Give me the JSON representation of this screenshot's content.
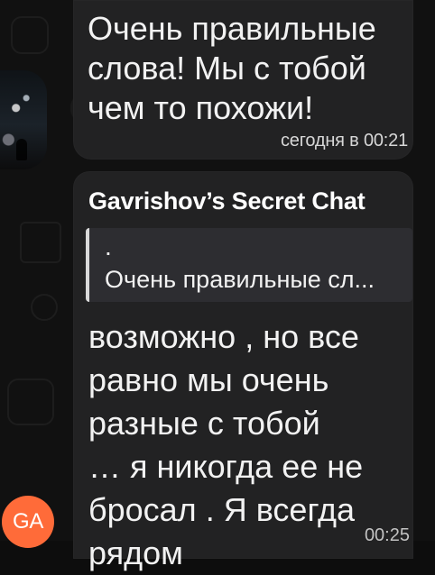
{
  "chat": {
    "outgoing_message": {
      "text": "Очень правильные\nслова! Мы с тобой\nчем то похожи!",
      "time": "сегодня в 00:21"
    },
    "incoming_message": {
      "sender_name": "Gavrishov’s Secret Chat",
      "reply_preview": {
        "marker": ".",
        "text": "Очень правильные сл..."
      },
      "text": "возможно , но все\nравно мы очень\nразные с тобой\n… я никогда ее не\nбросал . Я всегда\nрядом",
      "avatar_initials": "GA",
      "avatar_color": "#ff6b39",
      "time_partial": "00:25"
    }
  },
  "colors": {
    "background": "#111111",
    "bubble": "#222223",
    "reply_background": "#2d2d31",
    "text": "#f2f2f2"
  }
}
